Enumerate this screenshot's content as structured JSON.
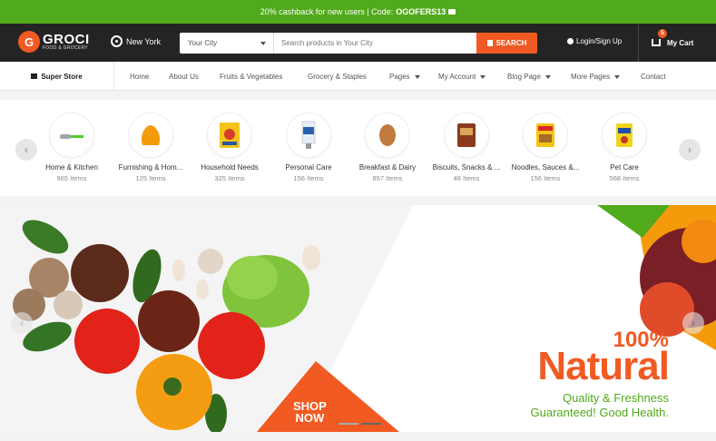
{
  "promo": {
    "text": "20% cashback for new users | Code:",
    "code": "OGOFERS13"
  },
  "header": {
    "logo_letter": "G",
    "logo_name": "GROCI",
    "logo_sub": "FOOD & GROCERY",
    "location": "New York",
    "city_select": "Your City",
    "search_placeholder": "Search products in Your City",
    "search_button": "SEARCH",
    "login": "Login/Sign Up",
    "cart_label": "My Cart",
    "cart_count": "5"
  },
  "nav": {
    "super_store": "Super Store",
    "items": [
      "Home",
      "About Us",
      "Fruits & Vegetables",
      "Grocery & Staples",
      "Pages",
      "My Account",
      "Blog Page",
      "More Pages",
      "Contact"
    ]
  },
  "categories": [
    {
      "name": "Home & Kitchen",
      "count": "965 Items",
      "icon": "kitchen-tool-icon"
    },
    {
      "name": "Furnishing & Hom...",
      "count": "125 Items",
      "icon": "beanbag-icon"
    },
    {
      "name": "Household Needs",
      "count": "325 Items",
      "icon": "detergent-pack-icon"
    },
    {
      "name": "Personal Care",
      "count": "156 Items",
      "icon": "toothpaste-icon"
    },
    {
      "name": "Breakfast & Dairy",
      "count": "857 Items",
      "icon": "egg-icon"
    },
    {
      "name": "Biscuits, Snacks & ...",
      "count": "48 Items",
      "icon": "snack-pack-icon"
    },
    {
      "name": "Noodles, Sauces &...",
      "count": "156 Items",
      "icon": "noodles-pack-icon"
    },
    {
      "name": "Pet Care",
      "count": "568 Items",
      "icon": "pet-food-icon"
    }
  ],
  "banner": {
    "shop_now_line1": "SHOP",
    "shop_now_line2": "NOW",
    "percent": "100%",
    "headline": "Natural",
    "tagline1": "Quality & Freshness",
    "tagline2": "Guaranteed! Good Health."
  },
  "colors": {
    "accent": "#f15a22",
    "green": "#51aa1b",
    "header_bg": "#242424"
  }
}
